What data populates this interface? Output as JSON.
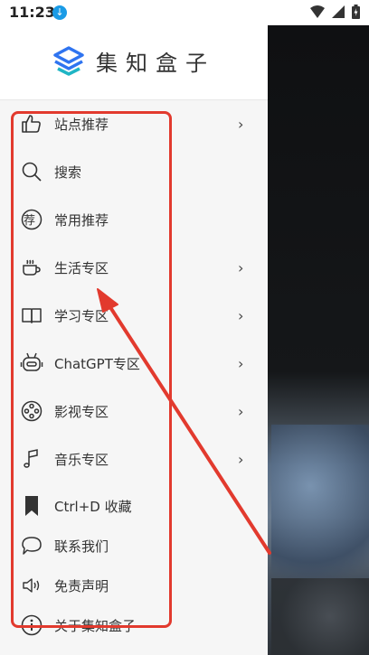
{
  "status_bar": {
    "time": "11:23",
    "download_icon": "download-icon"
  },
  "app": {
    "name": "集知盒子"
  },
  "colors": {
    "annotation": "#e23a2e",
    "logo_blue": "#2f74f0",
    "logo_teal": "#1fb5c5"
  },
  "menu": {
    "items": [
      {
        "label": "站点推荐",
        "icon": "thumbs-up-icon",
        "has_arrow": true
      },
      {
        "label": "搜索",
        "icon": "search-icon",
        "has_arrow": false
      },
      {
        "label": "常用推荐",
        "icon": "recommend-badge-icon",
        "has_arrow": false
      },
      {
        "label": "生活专区",
        "icon": "coffee-cup-icon",
        "has_arrow": true
      },
      {
        "label": "学习专区",
        "icon": "book-icon",
        "has_arrow": true
      },
      {
        "label": "ChatGPT专区",
        "icon": "robot-icon",
        "has_arrow": true
      },
      {
        "label": "影视专区",
        "icon": "film-reel-icon",
        "has_arrow": true
      },
      {
        "label": "音乐专区",
        "icon": "music-note-icon",
        "has_arrow": true
      },
      {
        "label": "Ctrl+D 收藏",
        "icon": "bookmark-icon",
        "has_arrow": false
      },
      {
        "label": "联系我们",
        "icon": "chat-bubble-icon",
        "has_arrow": false
      },
      {
        "label": "免责声明",
        "icon": "speaker-icon",
        "has_arrow": false
      },
      {
        "label": "关于集知盒子",
        "icon": "info-icon",
        "has_arrow": false
      }
    ],
    "arrow_glyph": "›",
    "badge_char": "荐"
  }
}
